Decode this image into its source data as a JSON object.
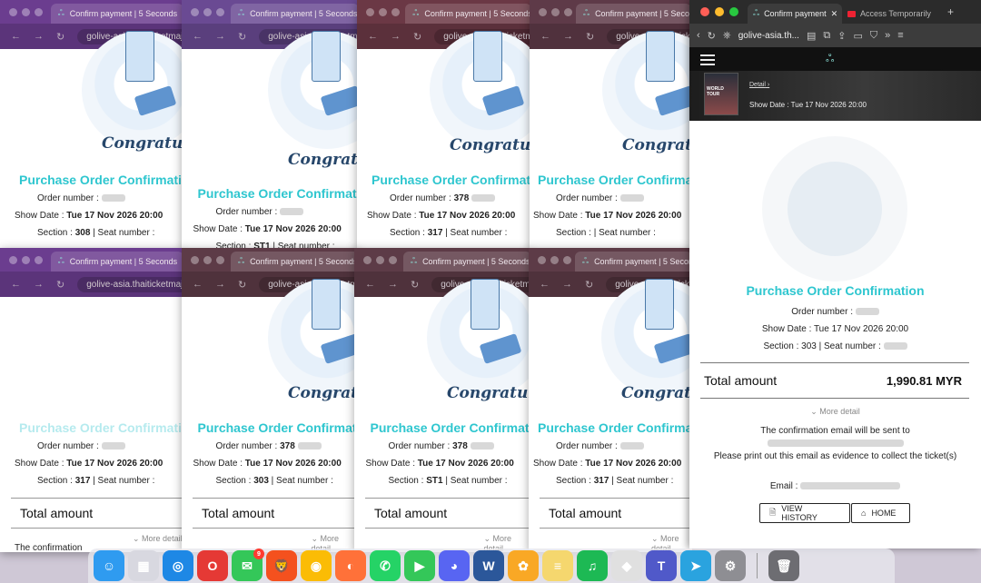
{
  "common": {
    "tab_title": "Confirm payment | 5 Seconds",
    "url": "golive-asia.thaiticketmajor.com",
    "congrats": "Congratulations",
    "poc": "Purchase Order Confirmation",
    "order_label": "Order number :",
    "showdate_label": "Show Date :",
    "showdate_value": "Tue 17 Nov 2026 20:00",
    "section_label": "Section :",
    "seat_label": "| Seat number :",
    "total_label": "Total amount",
    "more_detail": "More detail",
    "confirmation_text": "The confirmation"
  },
  "bg_windows": [
    {
      "order_value": "",
      "section_value": "308"
    },
    {
      "order_value": "",
      "section_value": "ST1"
    },
    {
      "order_value": "378",
      "section_value": "317"
    },
    {
      "order_value": "",
      "section_value": ""
    },
    {
      "order_value": "",
      "section_value": "317"
    },
    {
      "order_value": "378",
      "section_value": "303"
    },
    {
      "order_value": "378",
      "section_value": "ST1"
    },
    {
      "order_value": "",
      "section_value": "317"
    }
  ],
  "front": {
    "tab_active": "Confirm payment",
    "tab_inactive": "Access Temporarily",
    "url": "golive-asia.th...",
    "poster_text": "WORLD TOUR",
    "detail_link": "Detail",
    "showdate_header": "Show Date : Tue 17 Nov 2026 20:00",
    "title": "Purchase Order Confirmation",
    "order_label": "Order number :",
    "showdate_line": "Show Date : Tue 17 Nov 2026 20:00",
    "section_line": "Section : 303 | Seat number :",
    "total_label": "Total amount",
    "total_value": "1,990.81 MYR",
    "more_detail": "More detail",
    "email_sent": "The confirmation email will be sent to",
    "print_notice": "Please print out this email as evidence to collect the ticket(s)",
    "email_label": "Email :",
    "view_history": "VIEW HISTORY",
    "home": "HOME"
  },
  "dock_apps": [
    "Finder",
    "Launchpad",
    "Safari",
    "Opera",
    "Messages",
    "Brave",
    "Chrome",
    "Firefox",
    "WhatsApp",
    "FaceTime",
    "Discord",
    "Word",
    "Photos",
    "Notes",
    "Spotify",
    "Roblox",
    "Teams",
    "Telegram",
    "Settings",
    "Trash"
  ],
  "dock_badge": "9"
}
